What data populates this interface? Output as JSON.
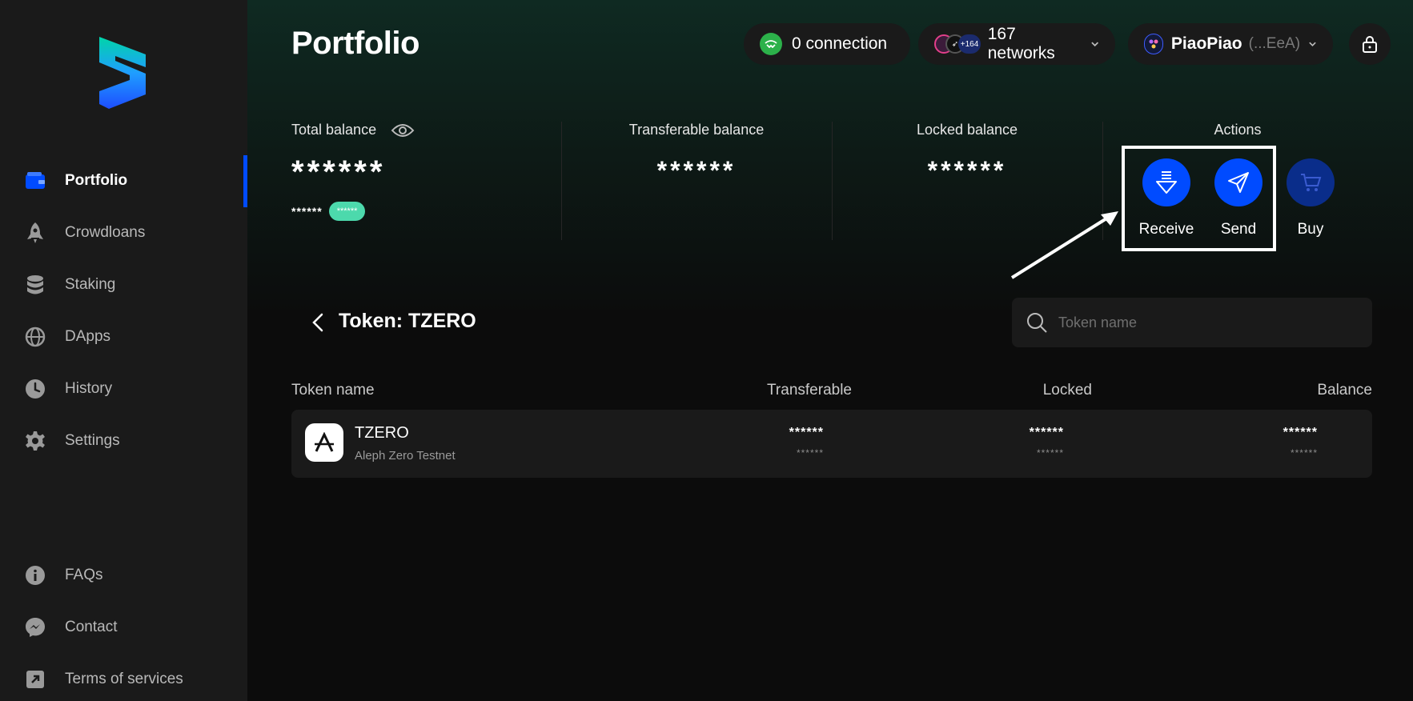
{
  "sidebar": {
    "logo": "subwallet-logo",
    "items": [
      {
        "label": "Portfolio",
        "icon": "wallet-icon",
        "active": true
      },
      {
        "label": "Crowdloans",
        "icon": "rocket-icon"
      },
      {
        "label": "Staking",
        "icon": "database-icon"
      },
      {
        "label": "DApps",
        "icon": "globe-icon"
      },
      {
        "label": "History",
        "icon": "clock-icon"
      },
      {
        "label": "Settings",
        "icon": "gear-icon"
      }
    ],
    "bottom_items": [
      {
        "label": "FAQs",
        "icon": "info-icon"
      },
      {
        "label": "Contact",
        "icon": "messenger-icon"
      },
      {
        "label": "Terms of services",
        "icon": "external-link-icon"
      }
    ]
  },
  "header": {
    "title": "Portfolio",
    "connection_label": "0 connection",
    "networks_badge": "+164",
    "networks_label": "167 networks",
    "account_name": "PiaoPiao",
    "account_address": "(...EeA)"
  },
  "balances": {
    "total_label": "Total balance",
    "total_value": "******",
    "total_sub_value": "******",
    "total_change": "******",
    "transferable_label": "Transferable balance",
    "transferable_value": "******",
    "locked_label": "Locked balance",
    "locked_value": "******",
    "actions_label": "Actions",
    "actions": [
      {
        "label": "Receive",
        "icon": "receive-icon"
      },
      {
        "label": "Send",
        "icon": "send-icon"
      },
      {
        "label": "Buy",
        "icon": "cart-icon",
        "disabled": true
      }
    ]
  },
  "token_section": {
    "title": "Token: TZERO",
    "search_placeholder": "Token name",
    "columns": [
      "Token name",
      "Transferable",
      "Locked",
      "Balance"
    ],
    "rows": [
      {
        "symbol": "TZERO",
        "network": "Aleph Zero Testnet",
        "transferable": "******",
        "transferable_sub": "******",
        "locked": "******",
        "locked_sub": "******",
        "balance": "******",
        "balance_sub": "******"
      }
    ]
  },
  "colors": {
    "accent": "#004bff",
    "sidebar_bg": "#1a1a1a",
    "main_bg": "#0c0c0c",
    "success": "#4cd9ac",
    "connection_green": "#2cb14a"
  }
}
